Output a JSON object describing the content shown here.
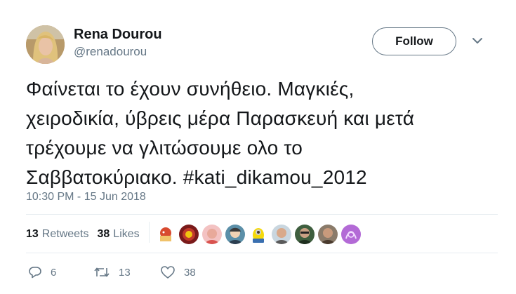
{
  "user": {
    "name": "Rena Dourou",
    "handle": "@renadourou",
    "follow_label": "Follow"
  },
  "tweet": {
    "line1": "Φαίνεται το έχουν συνήθειο. Μαγκιές,",
    "line2": "χειροδικία, ύβρεις μέρα Παρασκευή και μετά",
    "line3": "τρέχουμε να γλιτώσουμε ολο το",
    "line4_text": "Σαββατοκύριακο. ",
    "hashtag": "#kati_dikamou_2012",
    "timestamp": "10:30 PM - 15 Jun 2018"
  },
  "stats": {
    "retweets_count": "13",
    "retweets_label": "Retweets",
    "likes_count": "38",
    "likes_label": "Likes"
  },
  "actions": {
    "reply_count": "6",
    "retweet_count": "13",
    "like_count": "38"
  },
  "colors": {
    "text": "#14171a",
    "secondary": "#657786",
    "divider": "#e6ecf0"
  },
  "icons": [
    "chevron-down-icon",
    "reply-icon",
    "retweet-icon",
    "like-icon"
  ]
}
